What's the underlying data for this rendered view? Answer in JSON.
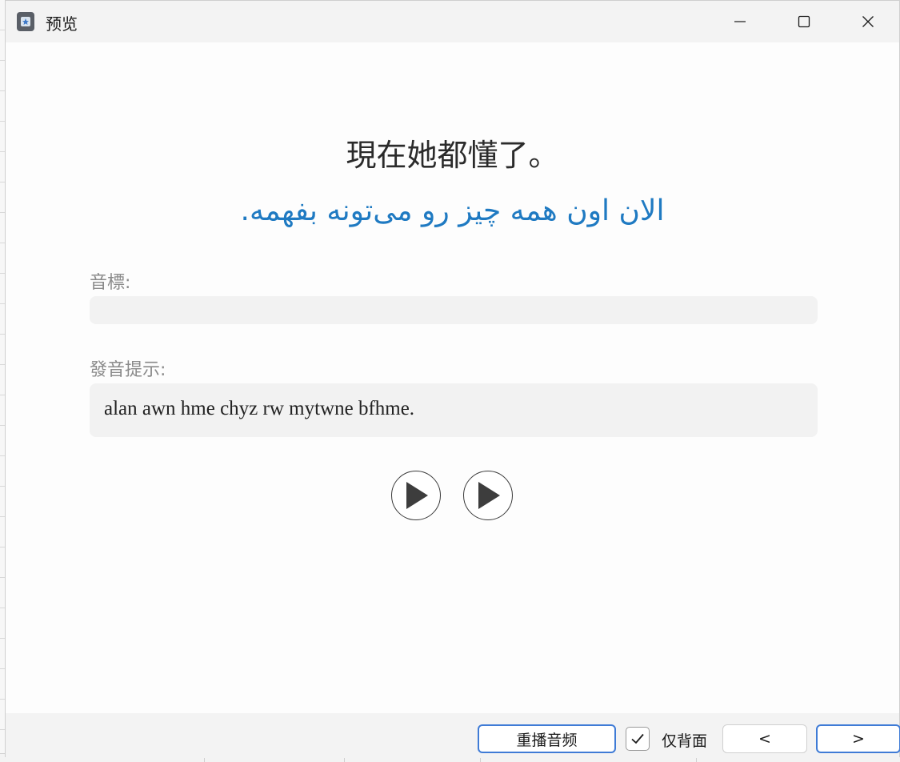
{
  "window": {
    "title": "预览"
  },
  "card": {
    "front": "現在她都懂了。",
    "back": "الان اون همه چیز رو می‌تونه بفهمه.",
    "phonetic_label": "音標:",
    "phonetic_value": "",
    "hint_label": "發音提示:",
    "hint_value": "alan awn hme chyz rw mytwne bfhme."
  },
  "footer": {
    "replay_label": "重播音频",
    "back_only_label": "仅背面",
    "back_only_checked": true,
    "prev_label": "<",
    "next_label": ">"
  },
  "colors": {
    "accent": "#3f7bd6",
    "back_text": "#1f7ac2"
  }
}
